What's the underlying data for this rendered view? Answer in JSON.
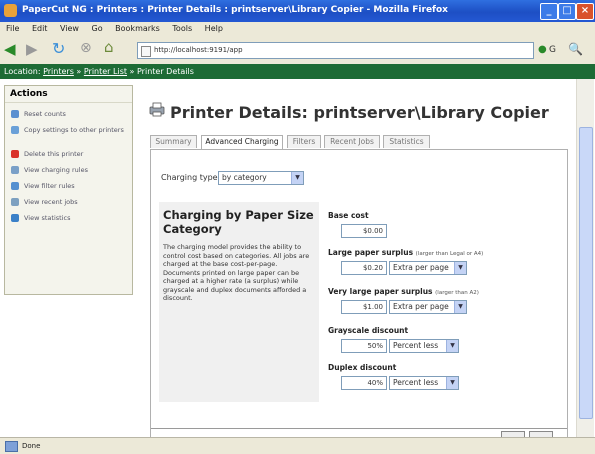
{
  "window": {
    "title": "PaperCut NG : Printers : Printer Details : printserver\\Library Copier - Mozilla Firefox",
    "minimize": "_",
    "maximize": "□",
    "close": "×"
  },
  "menu": [
    "File",
    "Edit",
    "View",
    "Go",
    "Bookmarks",
    "Tools",
    "Help"
  ],
  "address": {
    "url": "http://localhost:9191/app",
    "go_label": "G"
  },
  "location": {
    "prefix": "Location:",
    "crumbs": [
      "Printers",
      "Printer List",
      "Printer Details"
    ],
    "sep": "»"
  },
  "sidebar": {
    "title": "Actions",
    "items": [
      {
        "label": "Reset counts",
        "icon": "reset-icon",
        "color": "#5a8fd0"
      },
      {
        "label": "Copy settings to other printers",
        "icon": "copy-icon",
        "color": "#6aa0d8"
      },
      {
        "label": "Delete this printer",
        "icon": "delete-icon",
        "color": "#d9322a"
      },
      {
        "label": "View charging rules",
        "icon": "rules-icon",
        "color": "#7aa0c8"
      },
      {
        "label": "View filter rules",
        "icon": "filter-icon",
        "color": "#5590d0"
      },
      {
        "label": "View recent jobs",
        "icon": "jobs-icon",
        "color": "#7da0c0"
      },
      {
        "label": "View statistics",
        "icon": "stats-icon",
        "color": "#3a80c8"
      }
    ]
  },
  "page": {
    "title": "Printer Details: printserver\\Library Copier"
  },
  "tabs": [
    "Summary",
    "Advanced Charging",
    "Filters",
    "Recent Jobs",
    "Statistics"
  ],
  "charging": {
    "type_label": "Charging type:",
    "type_value": "by category",
    "heading": "Charging by Paper Size Category",
    "description": "The charging model provides the ability to control cost based on categories. All jobs are charged at the base cost-per-page. Documents printed on large paper can be charged at a higher rate (a surplus) while grayscale and duplex documents afforded a discount."
  },
  "fields": {
    "base_cost": {
      "label": "Base cost",
      "value": "$0.00"
    },
    "large_surplus": {
      "label": "Large paper surplus",
      "note": "(larger than Legal or A4)",
      "value": "$0.20",
      "mode": "Extra per page"
    },
    "very_large_surplus": {
      "label": "Very large paper surplus",
      "note": "(larger than A2)",
      "value": "$1.00",
      "mode": "Extra per page"
    },
    "grayscale": {
      "label": "Grayscale discount",
      "value": "50%",
      "mode": "Percent less"
    },
    "duplex": {
      "label": "Duplex discount",
      "value": "40%",
      "mode": "Percent less"
    }
  },
  "status": {
    "text": "Done"
  },
  "colors": {
    "header_green": "#1d6b35",
    "title_blue": "#2458d3"
  }
}
